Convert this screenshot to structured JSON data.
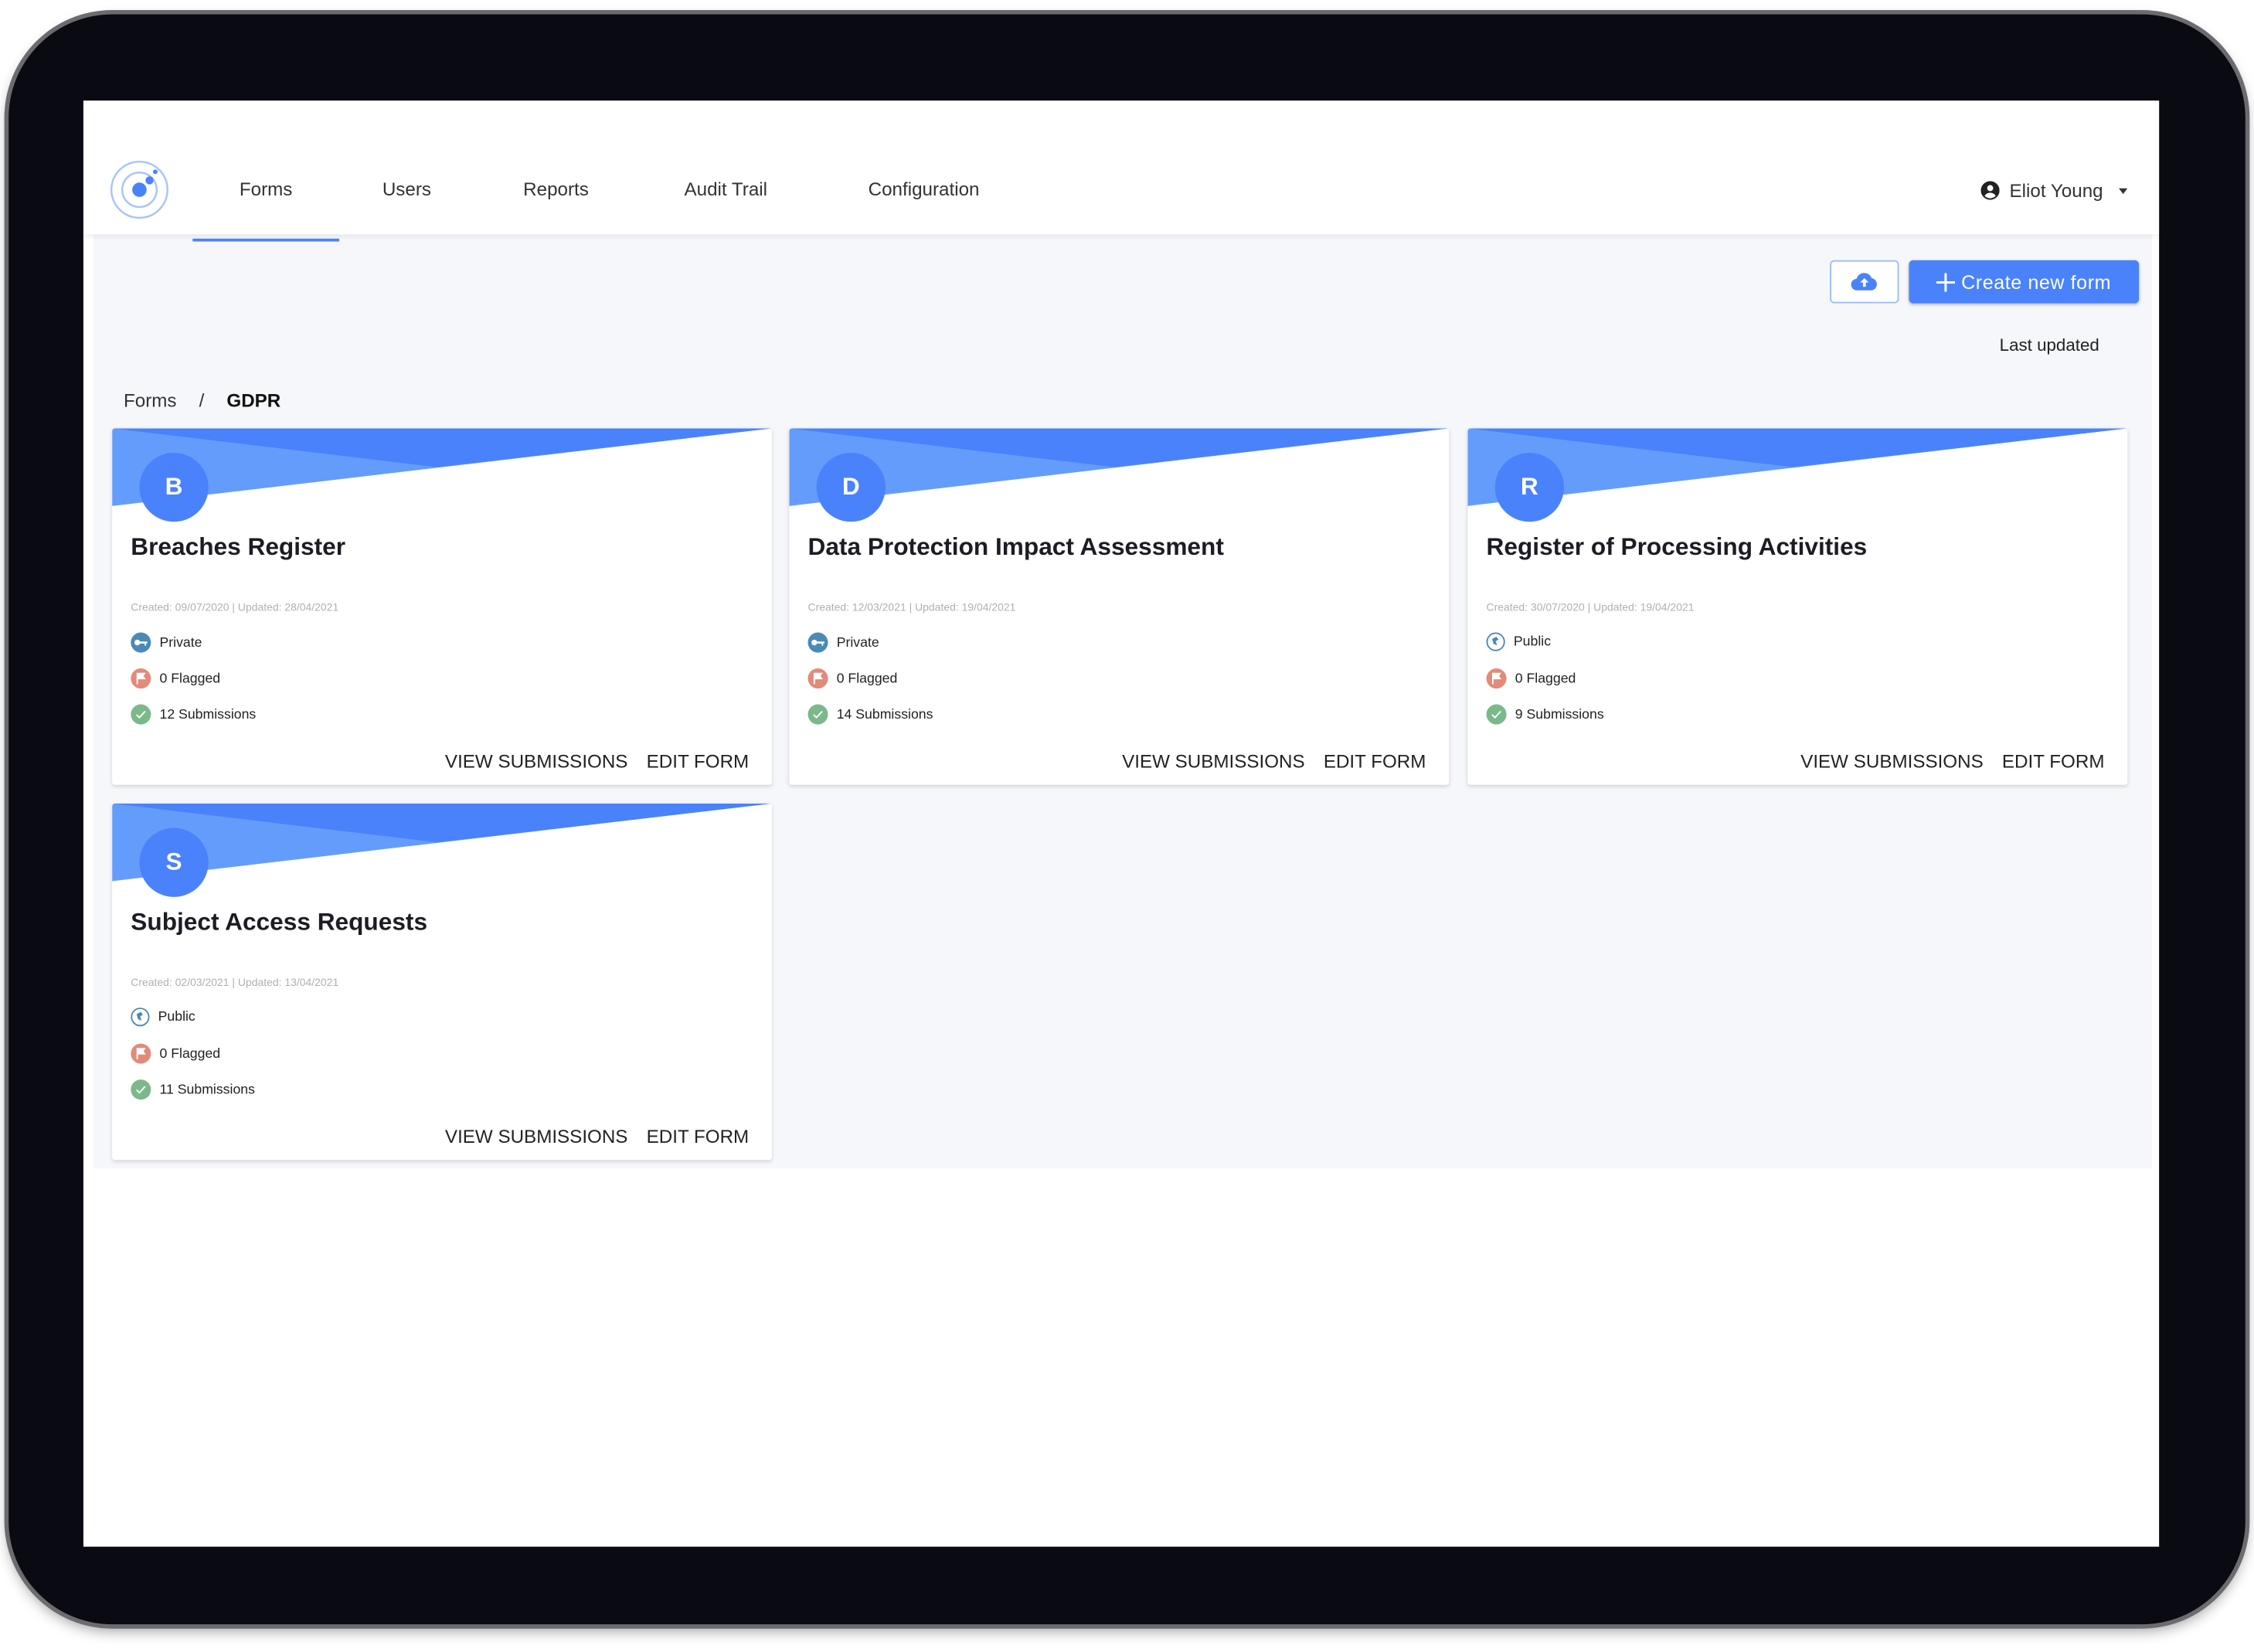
{
  "nav": {
    "tabs": [
      {
        "label": "Forms",
        "active": true
      },
      {
        "label": "Users"
      },
      {
        "label": "Reports"
      },
      {
        "label": "Audit Trail"
      },
      {
        "label": "Configuration"
      }
    ],
    "user_name": "Eliot Young"
  },
  "toolbar": {
    "upload_icon": "cloud-upload-icon",
    "create_label": "Create new form",
    "sort_label": "Last updated"
  },
  "breadcrumb": {
    "root": "Forms",
    "separator": "/",
    "current": "GDPR"
  },
  "colors": {
    "accent": "#4a82fb",
    "header_light": "#649cfc",
    "private": "#4a8ab8",
    "flagged": "#e38a7a",
    "submissions": "#7bb98a"
  },
  "cards": [
    {
      "initial": "B",
      "title": "Breaches Register",
      "dates": "Created: 09/07/2020 | Updated: 28/04/2021",
      "visibility": "Private",
      "flagged": "0 Flagged",
      "submissions": "12 Submissions",
      "view_label": "VIEW SUBMISSIONS",
      "edit_label": "EDIT FORM"
    },
    {
      "initial": "D",
      "title": "Data Protection Impact Assessment",
      "dates": "Created: 12/03/2021 | Updated: 19/04/2021",
      "visibility": "Private",
      "flagged": "0 Flagged",
      "submissions": "14 Submissions",
      "view_label": "VIEW SUBMISSIONS",
      "edit_label": "EDIT FORM"
    },
    {
      "initial": "R",
      "title": "Register of Processing Activities",
      "dates": "Created: 30/07/2020 | Updated: 19/04/2021",
      "visibility": "Public",
      "flagged": "0 Flagged",
      "submissions": "9 Submissions",
      "view_label": "VIEW SUBMISSIONS",
      "edit_label": "EDIT FORM"
    },
    {
      "initial": "S",
      "title": "Subject Access Requests",
      "dates": "Created: 02/03/2021 | Updated: 13/04/2021",
      "visibility": "Public",
      "flagged": "0 Flagged",
      "submissions": "11 Submissions",
      "view_label": "VIEW SUBMISSIONS",
      "edit_label": "EDIT FORM"
    }
  ]
}
